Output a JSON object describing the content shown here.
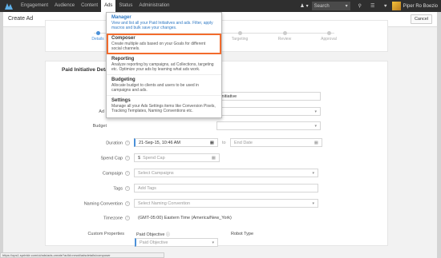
{
  "nav": {
    "items": [
      {
        "label": "Engagement"
      },
      {
        "label": "Audience"
      },
      {
        "label": "Content"
      },
      {
        "label": "Ads"
      },
      {
        "label": "Status"
      },
      {
        "label": "Administration"
      }
    ],
    "user_icon": "user-icon",
    "search_label": "Search",
    "username": "Piper Ro Boezio"
  },
  "page": {
    "title": "Create Ad",
    "cancel_label": "Cancel"
  },
  "steps": [
    {
      "label": "Details"
    },
    {
      "label": "Targeting"
    },
    {
      "label": "Review"
    },
    {
      "label": "Approval"
    }
  ],
  "panel": {
    "heading": "Paid Initiative Details"
  },
  "form": {
    "ad_label": "Ad",
    "budget_label": "Budget",
    "initiative_value": "Initiative",
    "duration_label": "Duration",
    "start_value": "21-Sep-15, 10:46 AM",
    "to_label": "to",
    "end_placeholder": "End Date",
    "spend_cap_label": "Spend Cap",
    "currency": "$",
    "spend_cap_placeholder": "Spend Cap",
    "campaign_label": "Campaign",
    "campaign_placeholder": "Select Campaigns",
    "tags_label": "Tags",
    "tags_placeholder": "Add Tags",
    "naming_label": "Naming Convention",
    "naming_placeholder": "Select Naming Convention",
    "timezone_label": "Timezone",
    "timezone_value": "(GMT-05:00) Eastern Time (America/New_York)",
    "custom_label": "Custom Properties",
    "paid_objective_label": "Paid Objective",
    "paid_objective_placeholder": "Paid Objective",
    "robot_type_label": "Robot Type"
  },
  "dropdown": {
    "items": [
      {
        "title": "Manager",
        "desc": "View and list all your Paid Initiatives and ads. Filter, apply macros and bulk save your changes."
      },
      {
        "title": "Composer",
        "desc": "Create multiple ads based on your Goals for different social channels."
      },
      {
        "title": "Reporting",
        "desc": "Analyze reporting by campaigns, ad Collections, targeting etc. Optimize your ads by learning what ads work."
      },
      {
        "title": "Budgeting",
        "desc": "Allocate budget to clients and users to be used in campaigns and ads."
      },
      {
        "title": "Settings",
        "desc": "Manage all your Ads Settings items like Conversion Pixels, Tracking Templates, Naming Conventions etc."
      }
    ]
  },
  "statusbar": {
    "url": "https://ops1.sprinklr.com/ui/ads/ads-create?adId=new#/adsdetails/composer"
  },
  "colors": {
    "accent": "#4a90d9",
    "highlight": "#f26b2c",
    "topbar": "#2f2f2f"
  }
}
